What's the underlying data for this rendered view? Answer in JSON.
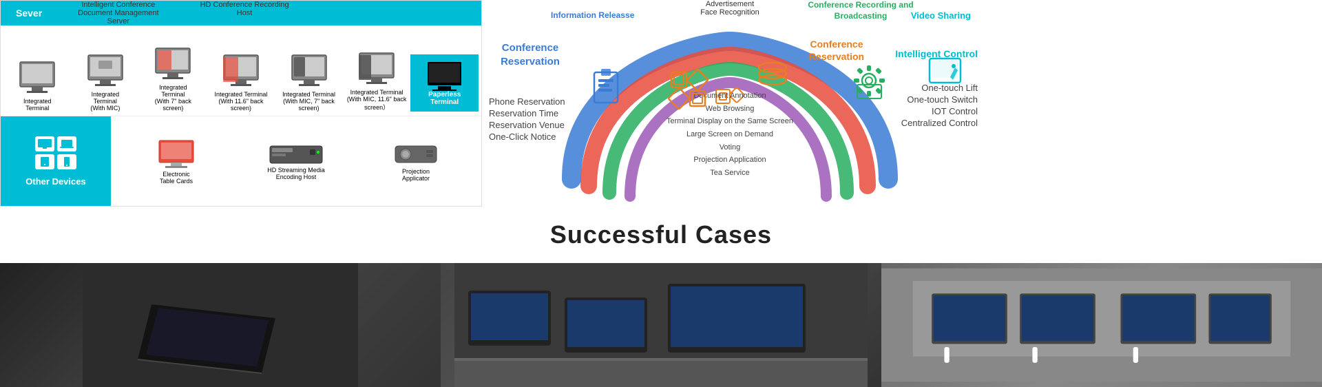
{
  "top": {
    "server_label": "Sever",
    "server_items": [
      {
        "label": "Intelligent Conference\nDocument Management\nServer"
      },
      {
        "label": "HD Conference Recording\nHost"
      }
    ],
    "integrated_items": [
      {
        "label": "Integrated\nTerminal"
      },
      {
        "label": "Integrated\nTerminal\n(With MIC)"
      },
      {
        "label": "Integrated\nTerminal\n(With 7\" back\nscreen)"
      },
      {
        "label": "Integrated Terminal\n(With 11.6\" back\nscreen)"
      },
      {
        "label": "Integrated Terminal\n(With MIC, 7\" back\nscreen)"
      },
      {
        "label": "Integrated Terminal\n(With MIC, 11.6\" back\nscreen）"
      }
    ],
    "paperless_label": "Paperless\nTerminal",
    "other_devices_label": "Other Devices",
    "bottom_devices": [
      {
        "label": "Electronic\nTable Cards"
      },
      {
        "label": "HD Streaming Media\nEncoding Host"
      },
      {
        "label": "Projection\nApplicator"
      }
    ]
  },
  "diagram": {
    "conference_reservation_label": "Conference Reservation",
    "info_release_label": "Information Releasse",
    "conf_reservation_right": "Conference\nReservation",
    "video_sharing_label": "Video Sharing",
    "recording_label": "Conference Recording\nand Broadcasting",
    "intelligent_control_label": "Intelligent Control",
    "advertisement_label": "Advertisement",
    "face_recognition_label": "Face Recognition",
    "left_list": [
      "Phone Reservation",
      "Reservation Time",
      "Reservation Venue",
      "One-Click Notice"
    ],
    "center_list": [
      "Document Annotation",
      "Web Browsing",
      "Terminal Display on the Same Screen",
      "Large Screen on Demand",
      "Voting",
      "Projection Application",
      "Tea Service"
    ],
    "right_list": [
      "One-touch Lift",
      "One-touch Switch",
      "IOT Control",
      "Centralized Control"
    ]
  },
  "cases": {
    "title": "Successful Cases"
  }
}
